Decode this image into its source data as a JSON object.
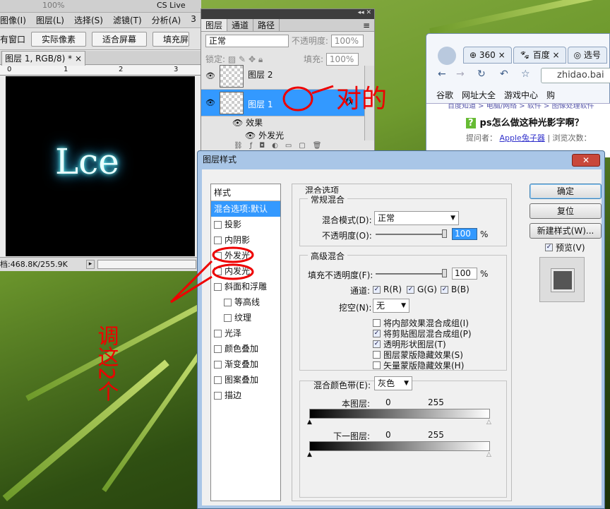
{
  "photoshop": {
    "menu": [
      "图像(I)",
      "图层(L)",
      "选择(S)",
      "滤镜(T)",
      "分析(A)",
      "3"
    ],
    "zoom": "100%",
    "cs_live": "CS Live",
    "options_bar": {
      "window_label": "有窗口",
      "actual_pixels": "实际像素",
      "fit_screen": "适合屏幕",
      "fill_screen": "填充屏"
    },
    "doc_tab": "图层 1, RGB/8) *",
    "ruler_marks": [
      "0",
      "1",
      "2",
      "3"
    ],
    "canvas_text": "Lce",
    "status": "档:468.8K/255.9K"
  },
  "layers_panel": {
    "tabs": [
      "图层",
      "通道",
      "路径"
    ],
    "blend_mode": "正常",
    "opacity_label": "不透明度:",
    "opacity": "100%",
    "lock_label": "锁定:",
    "fill_label": "填充:",
    "fill": "100%",
    "layers": [
      {
        "name": "图层 2"
      },
      {
        "name": "图层 1",
        "fx": "fx"
      }
    ],
    "effects_label": "效果",
    "effect_item": "外发光"
  },
  "dialog": {
    "title": "图层样式",
    "style_list": {
      "header": "样式",
      "active": "混合选项:默认",
      "items": [
        {
          "label": "投影",
          "checked": false
        },
        {
          "label": "内阴影",
          "checked": false
        },
        {
          "label": "外发光",
          "checked": false
        },
        {
          "label": "内发光",
          "checked": false
        },
        {
          "label": "斜面和浮雕",
          "checked": false
        },
        {
          "label": "等高线",
          "checked": false
        },
        {
          "label": "纹理",
          "checked": false
        },
        {
          "label": "光泽",
          "checked": false
        },
        {
          "label": "颜色叠加",
          "checked": false
        },
        {
          "label": "渐变叠加",
          "checked": false
        },
        {
          "label": "图案叠加",
          "checked": false
        },
        {
          "label": "描边",
          "checked": false
        }
      ]
    },
    "blending_options": "混合选项",
    "general_blending": "常规混合",
    "blend_mode_label": "混合模式(D):",
    "blend_mode": "正常",
    "opacity_label": "不透明度(O):",
    "opacity": "100",
    "advanced_blending": "高级混合",
    "fill_opacity_label": "填充不透明度(F):",
    "fill_opacity": "100",
    "percent": "%",
    "channels_label": "通道:",
    "channels": [
      "R(R)",
      "G(G)",
      "B(B)"
    ],
    "knockout_label": "挖空(N):",
    "knockout": "无",
    "advanced_checks": [
      {
        "label": "将内部效果混合成组(I)",
        "checked": false
      },
      {
        "label": "将剪贴图层混合成组(P)",
        "checked": true
      },
      {
        "label": "透明形状图层(T)",
        "checked": true
      },
      {
        "label": "图层蒙版隐藏效果(S)",
        "checked": false
      },
      {
        "label": "矢量蒙版隐藏效果(H)",
        "checked": false
      }
    ],
    "blend_if_label": "混合颜色带(E):",
    "blend_if": "灰色",
    "this_layer": "本图层:",
    "underlying_layer": "下一图层:",
    "range_low": "0",
    "range_high": "255",
    "buttons": {
      "ok": "确定",
      "reset": "复位",
      "new_style": "新建样式(W)...",
      "preview": "预览(V)"
    }
  },
  "browser": {
    "tabs": [
      "360",
      "百度",
      "选号"
    ],
    "url": "zhidao.bai",
    "bookmarks": [
      "谷歌",
      "网址大全",
      "游戏中心",
      "购"
    ],
    "breadcrumb": "百度知道 > 电脑/网络 > 软件 > 图像处理软件",
    "question": "ps怎么做这种光影字啊？",
    "asker_label": "提问者：",
    "asker": "Apple兔子器",
    "views": "浏览次数：",
    "asker_sep": "|"
  },
  "annotations": {
    "red_note_right": "对的",
    "red_note_left": "调这2个"
  },
  "colors": {
    "accent": "#3399ff",
    "glow": "#66ffff",
    "annotation": "#ff0000",
    "dialog_frame": "#a9c6e7"
  }
}
